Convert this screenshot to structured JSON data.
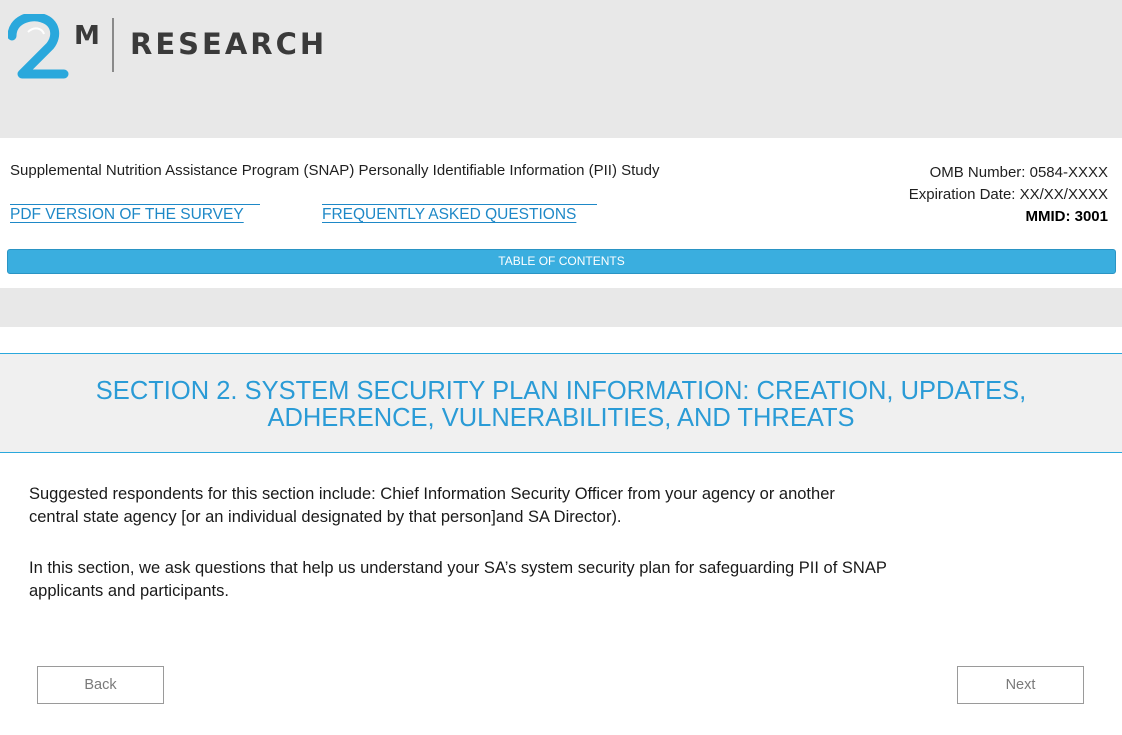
{
  "brand": {
    "logo_mark": "2",
    "logo_superscript": "M",
    "logo_text": "RESEARCH",
    "brand_color": "#2aa8dc"
  },
  "header": {
    "study_title": "Supplemental Nutrition Assistance Program (SNAP) Personally Identifiable Information (PII) Study",
    "omb_number": "OMB Number: 0584-XXXX",
    "expiration_date": "Expiration Date: XX/XX/XXXX",
    "mmid": "MMID: 3001",
    "links": {
      "pdf_version": "PDF VERSION OF THE SURVEY",
      "faq": "FREQUENTLY ASKED QUESTIONS"
    },
    "toc_label": "TABLE OF CONTENTS"
  },
  "section": {
    "title_line1": "SECTION 2. SYSTEM SECURITY PLAN INFORMATION: CREATION, UPDATES,",
    "title_line2": "ADHERENCE, VULNERABILITIES, AND THREATS",
    "paragraph1_line1": "Suggested respondents for this section include: Chief Information Security Officer from your agency or another",
    "paragraph1_line2": "central state agency [or an individual designated by that person]and SA Director).",
    "paragraph2_line1": "In this section, we ask questions that help us understand your SA’s system security plan for safeguarding PII of SNAP",
    "paragraph2_line2": "applicants and participants."
  },
  "nav": {
    "back_label": "Back",
    "next_label": "Next"
  },
  "colors": {
    "accent": "#2a9bd6",
    "toc_bar": "#3aaedf",
    "link": "#1e88c7",
    "page_bg": "#e8e8e8"
  }
}
